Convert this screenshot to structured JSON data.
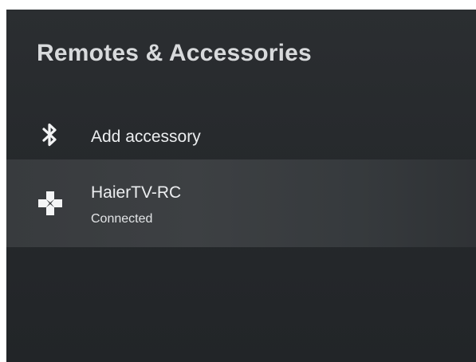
{
  "panel": {
    "title": "Remotes & Accessories"
  },
  "items": [
    {
      "label": "Add accessory",
      "icon": "bluetooth-icon"
    },
    {
      "label": "HaierTV-RC",
      "status": "Connected",
      "icon": "gamepad-icon"
    }
  ],
  "colors": {
    "background": "#272a2d",
    "focused_row": "#3b3e41",
    "text": "#eceef0"
  }
}
